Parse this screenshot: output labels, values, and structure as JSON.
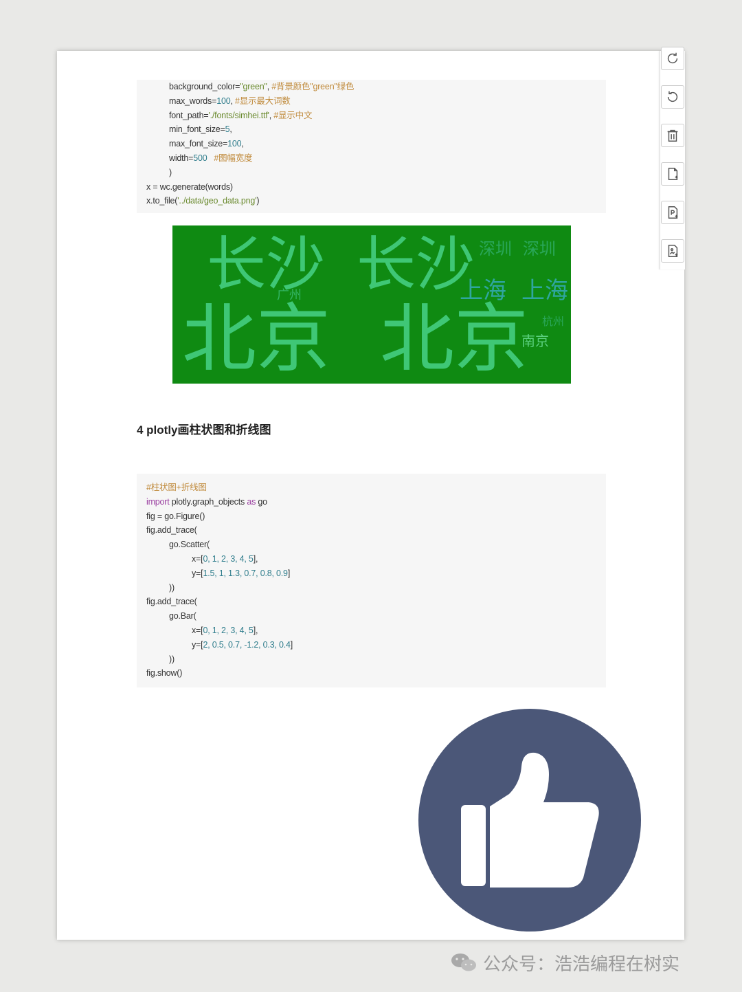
{
  "code_block_1": {
    "lines": [
      {
        "indent": 1,
        "parts": [
          [
            "plain",
            "background_color="
          ],
          [
            "str",
            "\"green\""
          ],
          [
            "plain",
            ", "
          ],
          [
            "cm",
            "#背景颜色\"green\"绿色"
          ]
        ]
      },
      {
        "indent": 1,
        "parts": [
          [
            "plain",
            "max_words="
          ],
          [
            "num",
            "100"
          ],
          [
            "plain",
            ", "
          ],
          [
            "cm",
            "#显示最大词数"
          ]
        ]
      },
      {
        "indent": 1,
        "parts": [
          [
            "plain",
            "font_path="
          ],
          [
            "str",
            "'./fonts/simhei.ttf'"
          ],
          [
            "plain",
            ", "
          ],
          [
            "cm",
            "#显示中文"
          ]
        ]
      },
      {
        "indent": 1,
        "parts": [
          [
            "plain",
            "min_font_size="
          ],
          [
            "num",
            "5"
          ],
          [
            "plain",
            ","
          ]
        ]
      },
      {
        "indent": 1,
        "parts": [
          [
            "plain",
            "max_font_size="
          ],
          [
            "num",
            "100"
          ],
          [
            "plain",
            ","
          ]
        ]
      },
      {
        "indent": 1,
        "parts": [
          [
            "plain",
            "width="
          ],
          [
            "num",
            "500"
          ],
          [
            "plain",
            "   "
          ],
          [
            "cm",
            "#图幅宽度"
          ]
        ]
      },
      {
        "indent": 1,
        "parts": [
          [
            "plain",
            ")"
          ]
        ]
      },
      {
        "indent": 0,
        "parts": [
          [
            "plain",
            "x = wc.generate(words)"
          ]
        ]
      },
      {
        "indent": 0,
        "parts": [
          [
            "plain",
            "x.to_file("
          ],
          [
            "str",
            "'../data/geo_data.png'"
          ],
          [
            "plain",
            ")"
          ]
        ]
      }
    ]
  },
  "wordcloud": {
    "background": "#0f8a12",
    "words": [
      {
        "text": "长沙",
        "size": 86
      },
      {
        "text": "长沙",
        "size": 86
      },
      {
        "text": "深圳",
        "size": 24
      },
      {
        "text": "深圳",
        "size": 24
      },
      {
        "text": "广州",
        "size": 18
      },
      {
        "text": "上海",
        "size": 34
      },
      {
        "text": "上海",
        "size": 34
      },
      {
        "text": "北京",
        "size": 108
      },
      {
        "text": "北京",
        "size": 108
      },
      {
        "text": "杭州",
        "size": 16
      },
      {
        "text": "南京",
        "size": 20
      }
    ]
  },
  "section_heading": "4 plotly画柱状图和折线图",
  "code_block_2": {
    "lines": [
      {
        "indent": 0,
        "parts": [
          [
            "cm",
            "#柱状图+折线图"
          ]
        ]
      },
      {
        "indent": 0,
        "parts": [
          [
            "kw",
            "import"
          ],
          [
            "plain",
            " plotly.graph_objects "
          ],
          [
            "kw",
            "as"
          ],
          [
            "plain",
            " go"
          ]
        ]
      },
      {
        "indent": 0,
        "parts": [
          [
            "plain",
            "fig = go.Figure()"
          ]
        ]
      },
      {
        "indent": 0,
        "parts": [
          [
            "plain",
            "fig.add_trace("
          ]
        ]
      },
      {
        "indent": 1,
        "parts": [
          [
            "plain",
            "go.Scatter("
          ]
        ]
      },
      {
        "indent": 2,
        "parts": [
          [
            "plain",
            "x=["
          ],
          [
            "num",
            "0, 1, 2, 3, 4, 5"
          ],
          [
            "plain",
            "],"
          ]
        ]
      },
      {
        "indent": 2,
        "parts": [
          [
            "plain",
            "y=["
          ],
          [
            "num",
            "1.5, 1, 1.3, 0.7, 0.8, 0.9"
          ],
          [
            "plain",
            "]"
          ]
        ]
      },
      {
        "indent": 1,
        "parts": [
          [
            "plain",
            "))"
          ]
        ]
      },
      {
        "indent": 0,
        "parts": [
          [
            "plain",
            "fig.add_trace("
          ]
        ]
      },
      {
        "indent": 1,
        "parts": [
          [
            "plain",
            "go.Bar("
          ]
        ]
      },
      {
        "indent": 2,
        "parts": [
          [
            "plain",
            "x=["
          ],
          [
            "num",
            "0, 1, 2, 3, 4, 5"
          ],
          [
            "plain",
            "],"
          ]
        ]
      },
      {
        "indent": 2,
        "parts": [
          [
            "plain",
            "y=["
          ],
          [
            "num",
            "2, 0.5, 0.7, -1.2, 0.3, 0.4"
          ],
          [
            "plain",
            "]"
          ]
        ]
      },
      {
        "indent": 1,
        "parts": [
          [
            "plain",
            "))"
          ]
        ]
      },
      {
        "indent": 0,
        "parts": [
          [
            "plain",
            "fig.show()"
          ]
        ]
      }
    ]
  },
  "toolbar": {
    "buttons": [
      "refresh-icon",
      "undo-icon",
      "trash-icon",
      "add-page-icon",
      "add-pdf-page-icon",
      "add-image-page-icon"
    ]
  },
  "overlay": {
    "icon": "thumbs-up-icon",
    "color": "#4b5778"
  },
  "watermark": {
    "text": "公众号：浩浩编程在树实"
  }
}
